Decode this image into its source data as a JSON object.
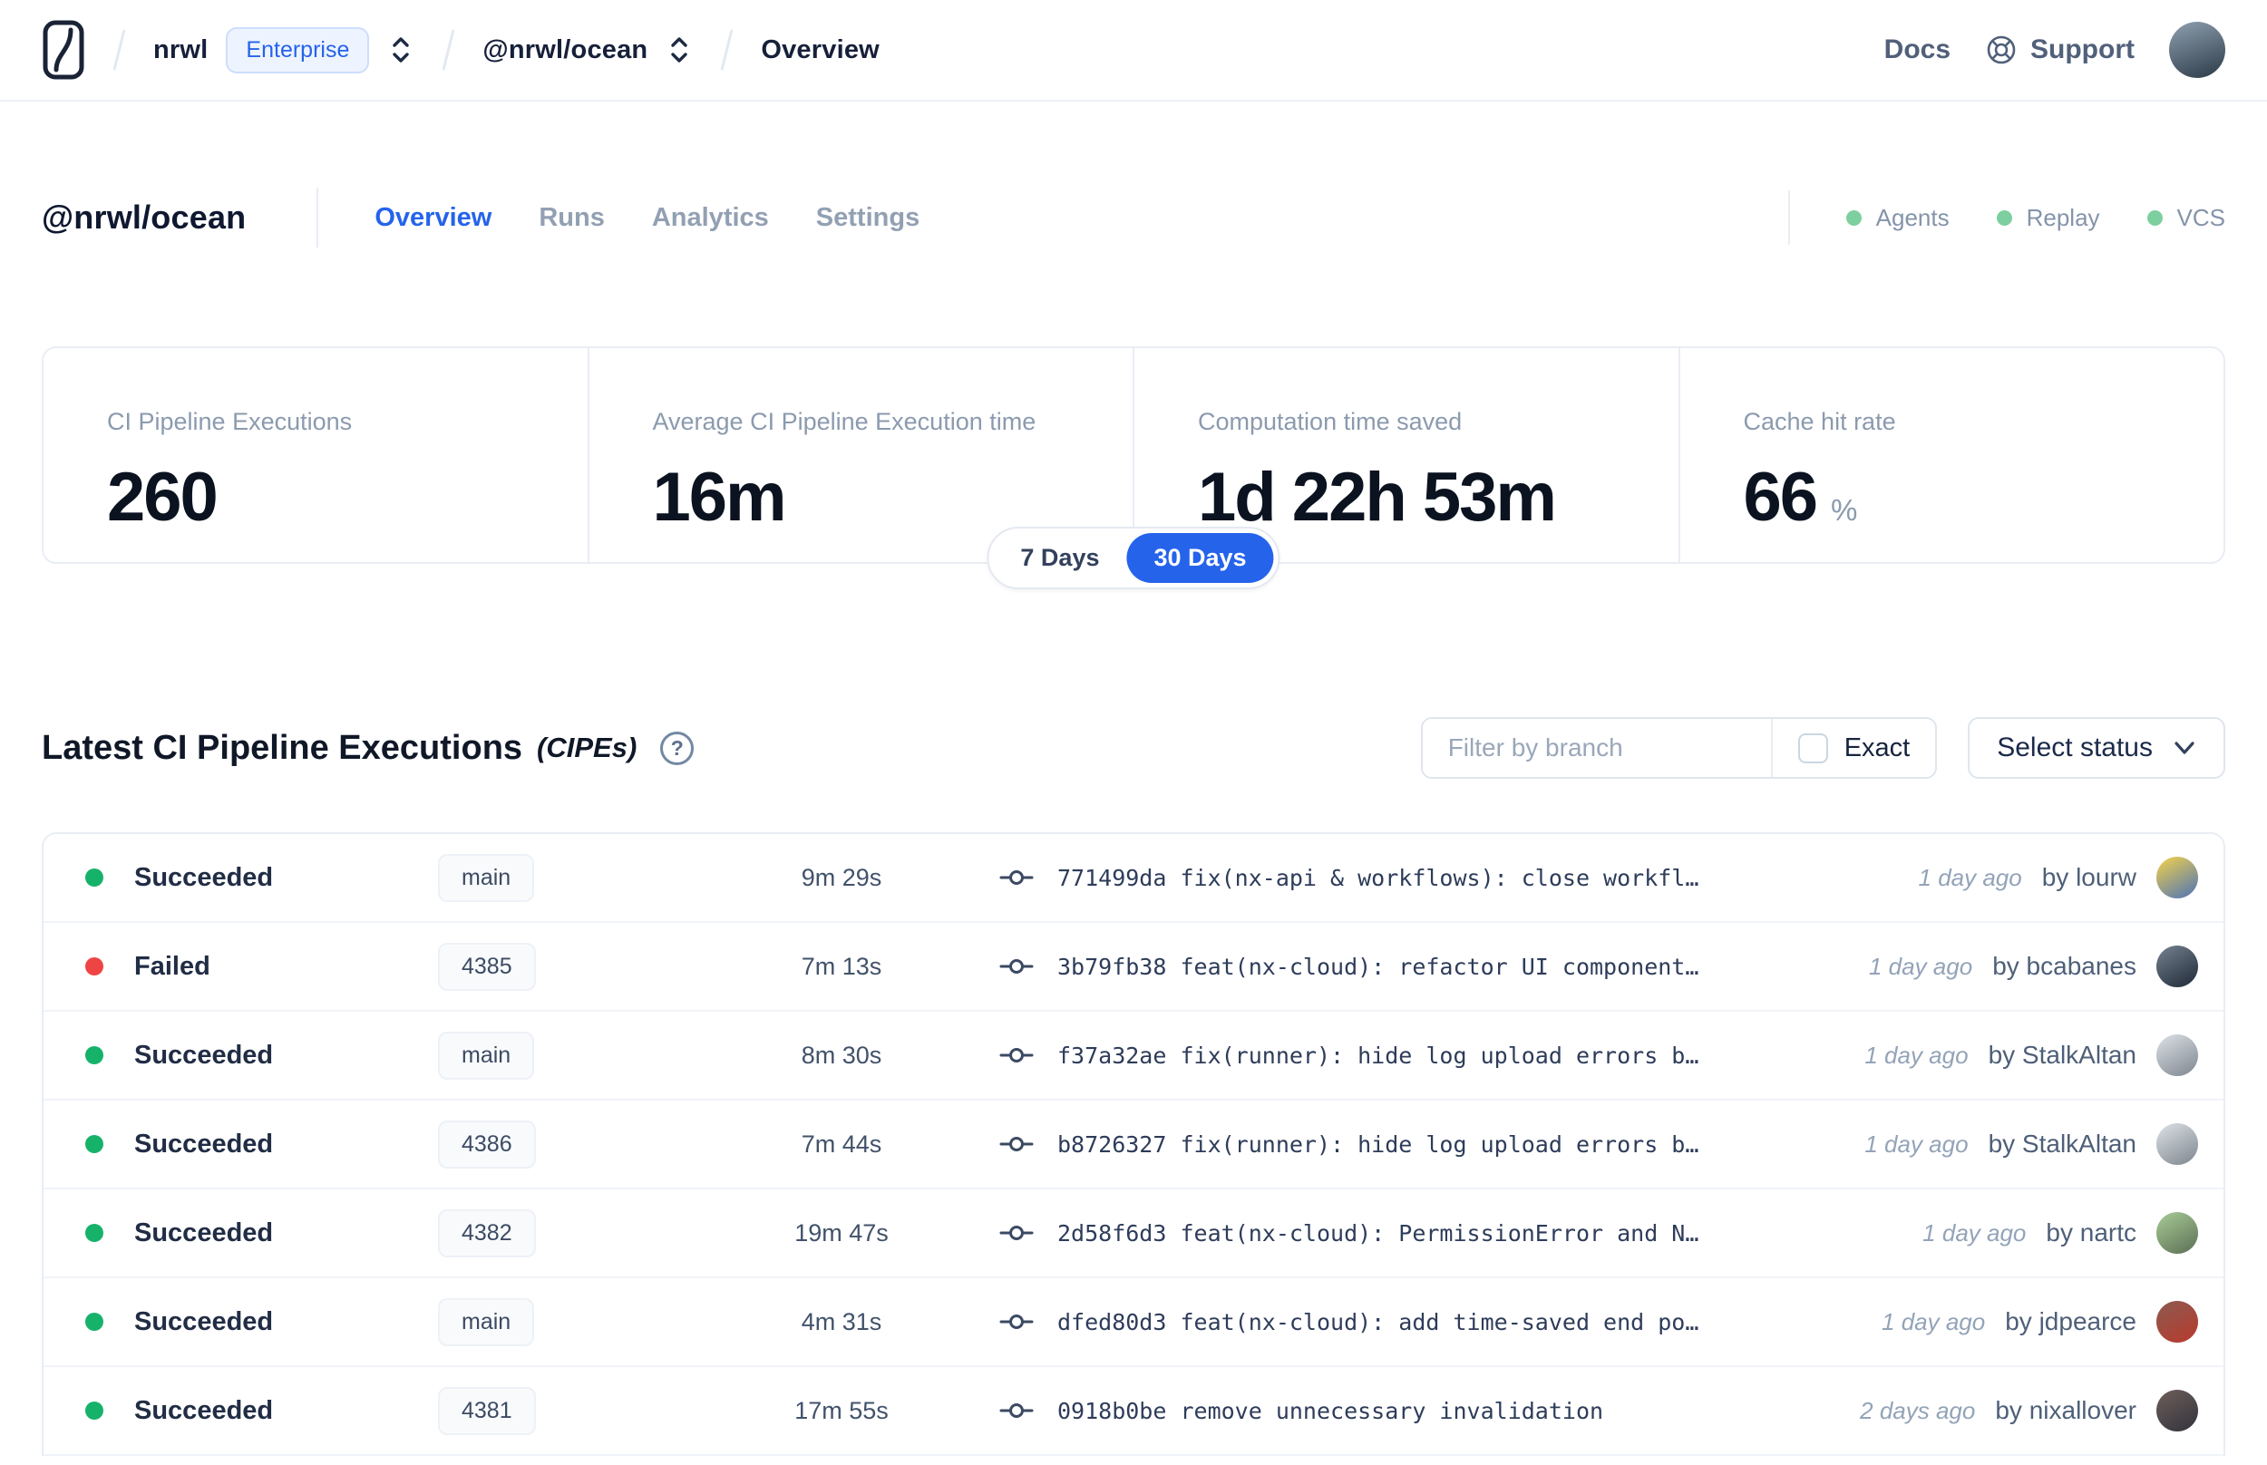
{
  "header": {
    "breadcrumb": {
      "org": "nrwl",
      "org_badge": "Enterprise",
      "workspace": "@nrwl/ocean",
      "page": "Overview"
    },
    "nav": {
      "docs": "Docs",
      "support": "Support"
    },
    "avatar_colors": [
      "#8fa0b0",
      "#2b3a47"
    ]
  },
  "page": {
    "title": "@nrwl/ocean",
    "tabs": [
      {
        "label": "Overview",
        "active": true
      },
      {
        "label": "Runs",
        "active": false
      },
      {
        "label": "Analytics",
        "active": false
      },
      {
        "label": "Settings",
        "active": false
      }
    ],
    "features": [
      "Agents",
      "Replay",
      "VCS"
    ],
    "feature_dot_color": "#7ecf9f"
  },
  "stats": {
    "cards": [
      {
        "label": "CI Pipeline Executions",
        "value": "260",
        "suffix": ""
      },
      {
        "label": "Average CI Pipeline Execution time",
        "value": "16m",
        "suffix": ""
      },
      {
        "label": "Computation time saved",
        "value": "1d 22h 53m",
        "suffix": ""
      },
      {
        "label": "Cache hit rate",
        "value": "66",
        "suffix": "%"
      }
    ],
    "range_toggle": {
      "options": [
        "7 Days",
        "30 Days"
      ],
      "selected": "30 Days",
      "active_color": "#2563eb"
    }
  },
  "cipe_section": {
    "title": "Latest CI Pipeline Executions",
    "title_suffix": "(CIPEs)",
    "filter_placeholder": "Filter by branch",
    "exact_label": "Exact",
    "status_select_label": "Select status",
    "status_colors": {
      "Succeeded": "#17b26a",
      "Failed": "#ef4444"
    },
    "rows": [
      {
        "status": "Succeeded",
        "status_color": "#17b26a",
        "branch": "main",
        "duration": "9m 29s",
        "commit": "771499da fix(nx-api & workflows): close workfl…",
        "time_ago": "1 day ago",
        "author": "by lourw",
        "avatar_colors": [
          "#f6d34a",
          "#4a72b8"
        ]
      },
      {
        "status": "Failed",
        "status_color": "#ef4444",
        "branch": "4385",
        "duration": "7m 13s",
        "commit": "3b79fb38 feat(nx-cloud): refactor UI component…",
        "time_ago": "1 day ago",
        "author": "by bcabanes",
        "avatar_colors": [
          "#75828f",
          "#1f2937"
        ]
      },
      {
        "status": "Succeeded",
        "status_color": "#17b26a",
        "branch": "main",
        "duration": "8m 30s",
        "commit": "f37a32ae fix(runner): hide log upload errors b…",
        "time_ago": "1 day ago",
        "author": "by StalkAltan",
        "avatar_colors": [
          "#dde2e7",
          "#7d858e"
        ]
      },
      {
        "status": "Succeeded",
        "status_color": "#17b26a",
        "branch": "4386",
        "duration": "7m 44s",
        "commit": "b8726327 fix(runner): hide log upload errors b…",
        "time_ago": "1 day ago",
        "author": "by StalkAltan",
        "avatar_colors": [
          "#dde2e7",
          "#7d858e"
        ]
      },
      {
        "status": "Succeeded",
        "status_color": "#17b26a",
        "branch": "4382",
        "duration": "19m 47s",
        "commit": "2d58f6d3 feat(nx-cloud): PermissionError and N…",
        "time_ago": "1 day ago",
        "author": "by nartc",
        "avatar_colors": [
          "#a8cc96",
          "#5c6e55"
        ]
      },
      {
        "status": "Succeeded",
        "status_color": "#17b26a",
        "branch": "main",
        "duration": "4m 31s",
        "commit": "dfed80d3 feat(nx-cloud): add time-saved end po…",
        "time_ago": "1 day ago",
        "author": "by jdpearce",
        "avatar_colors": [
          "#8c5a4f",
          "#b93a2e"
        ]
      },
      {
        "status": "Succeeded",
        "status_color": "#17b26a",
        "branch": "4381",
        "duration": "17m 55s",
        "commit": "0918b0be remove unnecessary invalidation",
        "time_ago": "2 days ago",
        "author": "by nixallover",
        "avatar_colors": [
          "#6e5f5a",
          "#32323c"
        ]
      }
    ]
  }
}
